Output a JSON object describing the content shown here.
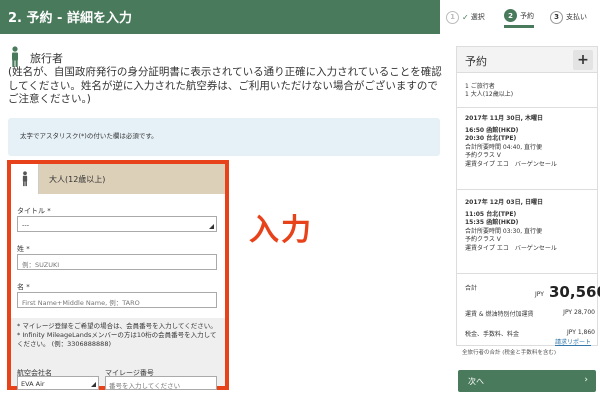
{
  "header": {
    "title": "2. 予約 - 詳細を入力"
  },
  "steps": [
    {
      "num": "1",
      "check": "✓",
      "label": "選択"
    },
    {
      "num": "2",
      "label": "予約"
    },
    {
      "num": "3",
      "label": "支払い"
    }
  ],
  "traveler": {
    "label": "旅行者",
    "note": "(姓名が、自国政府発行の身分証明書に表示されている通り正確に入力されていることを確認してください。姓名が逆に入力された航空券は、ご利用いただけない場合がございますのでご注意ください。)"
  },
  "info": "太字でアスタリスク(*)の付いた欄は必須です。",
  "form": {
    "card_title": "大人(12歳以上)",
    "title_label": "タイトル *",
    "title_value": "---",
    "last_label": "姓 *",
    "last_placeholder": "例：SUZUKI",
    "first_label": "名 *",
    "first_placeholder": "First Name+Middle Name, 例：TARO",
    "mileage_note1": "* マイレージ登録をご希望の場合は、会員番号を入力してください。",
    "mileage_note2": "* Infinity MileageLandsメンバーの方は10桁の会員番号を入力してください。 (例：3306888888)",
    "airline_label": "航空会社名",
    "airline_value": "EVA Air",
    "mileage_label": "マイレージ番号",
    "mileage_placeholder": "番号を入力してください"
  },
  "callout": "入力",
  "sidebar": {
    "title": "予約",
    "plus": "+",
    "pax_line1": "1 ご旅行者",
    "pax_line2": "1 大人(12歳以上)",
    "seg1": {
      "date": "2017年 11月 30日, 木曜日",
      "dep": "16:50 函館(HKD)",
      "arr": "20:30 台北(TPE)",
      "dur": "合計所要時間 04:40, 直行便",
      "cls": "予約クラス V",
      "fare": "運賃タイプ エコ　バーゲンセール"
    },
    "seg2": {
      "date": "2017年 12月 03日, 日曜日",
      "dep": "11:05 台北(TPE)",
      "arr": "15:35 函館(HKD)",
      "dur": "合計所要時間 03:30, 直行便",
      "cls": "予約クラス V",
      "fare": "運賃タイプ エコ　バーゲンセール"
    },
    "total_label": "合計",
    "currency": "JPY",
    "total": "30,560",
    "fare_label": "運賃 & 燃油特別付加運賃",
    "fare_value": "JPY 28,700",
    "tax_label": "税金、手数料、料金",
    "tax_value": "JPY 1,860",
    "details_link": "請求リポート",
    "foot": "全旅行者の合計 (税金と手数料を含む)"
  },
  "next_button": {
    "label": "次へ",
    "arrow": "›"
  }
}
